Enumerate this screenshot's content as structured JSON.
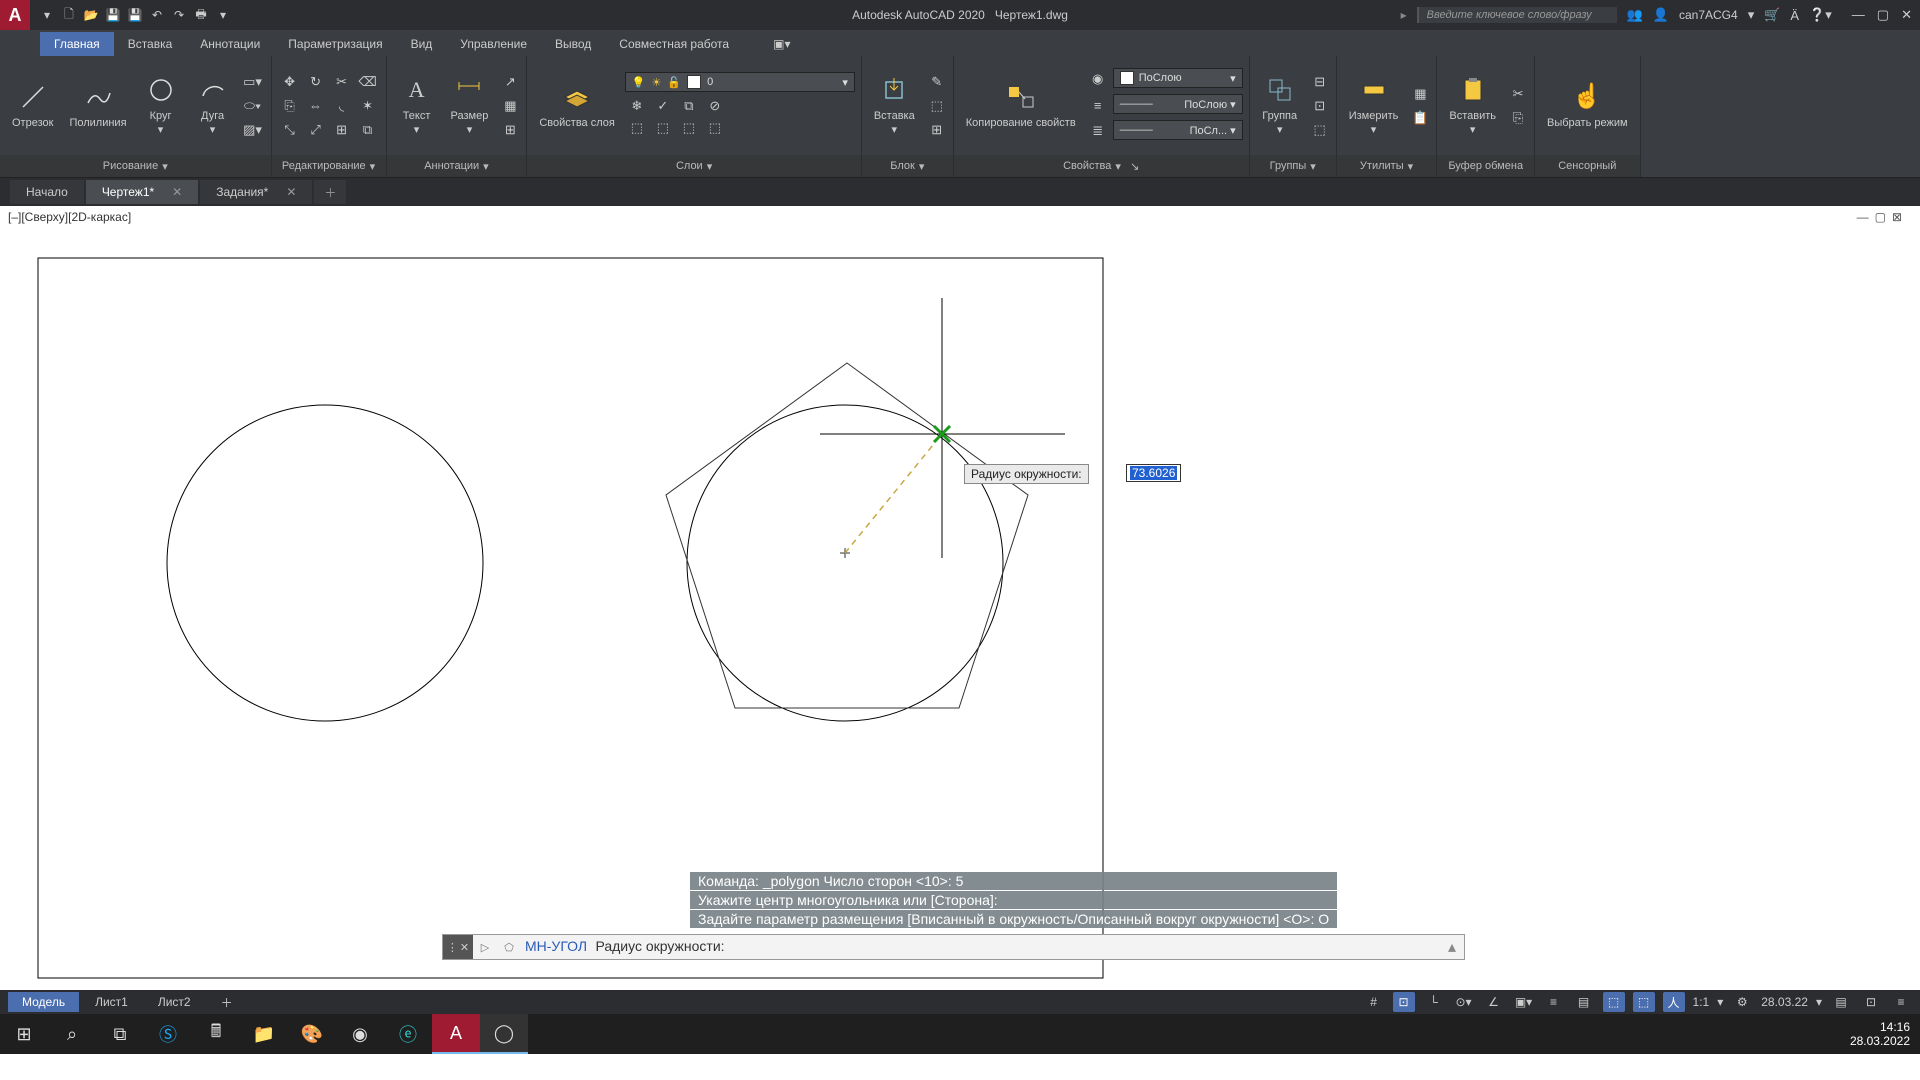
{
  "title_bar": {
    "app_name": "Autodesk AutoCAD 2020",
    "filename": "Чертеж1.dwg",
    "search_placeholder": "Введите ключевое слово/фразу",
    "username": "can7ACG4"
  },
  "ribbon_tabs": [
    "Главная",
    "Вставка",
    "Аннотации",
    "Параметризация",
    "Вид",
    "Управление",
    "Вывод",
    "Совместная работа"
  ],
  "ribbon_active_tab": 0,
  "panels": {
    "draw": {
      "title": "Рисование",
      "line": "Отрезок",
      "polyline": "Полилиния",
      "circle": "Круг",
      "arc": "Дуга"
    },
    "modify": {
      "title": "Редактирование"
    },
    "annot": {
      "title": "Аннотации",
      "text": "Текст",
      "dim": "Размер"
    },
    "layers": {
      "title": "Слои",
      "props": "Свойства слоя",
      "current": "0"
    },
    "block": {
      "title": "Блок",
      "insert": "Вставка"
    },
    "props": {
      "title": "Свойства",
      "match": "Копирование свойств",
      "bylayer": "ПоСлою",
      "bylayer2": "ПоСлою",
      "bylayer3": "ПоСл..."
    },
    "groups": {
      "title": "Группы",
      "group": "Группа"
    },
    "utils": {
      "title": "Утилиты",
      "measure": "Измерить"
    },
    "clip": {
      "title": "Буфер обмена",
      "paste": "Вставить"
    },
    "touch": {
      "title": "Сенсорный",
      "select": "Выбрать режим"
    }
  },
  "file_tabs": [
    {
      "label": "Начало",
      "closable": false
    },
    {
      "label": "Чертеж1*",
      "closable": true,
      "active": true
    },
    {
      "label": "Задания*",
      "closable": true
    }
  ],
  "viewport_label": "[–][Сверху][2D-каркас]",
  "tooltip": {
    "label": "Радиус окружности:",
    "value": "73.6026"
  },
  "cmd_history": [
    "Команда: _polygon Число сторон <10>: 5",
    "Укажите центр многоугольника или [Сторона]:",
    "Задайте параметр размещения [Вписанный в окружность/Описанный вокруг окружности] <О>: О"
  ],
  "cmdbar": {
    "cmd_name": "МН-УГОЛ",
    "prompt": "Радиус окружности:"
  },
  "layout_tabs": [
    "Модель",
    "Лист1",
    "Лист2"
  ],
  "status": {
    "scale": "1:1",
    "date": "28.03.22"
  },
  "taskbar": {
    "time": "14:16",
    "date": "28.03.2022"
  }
}
